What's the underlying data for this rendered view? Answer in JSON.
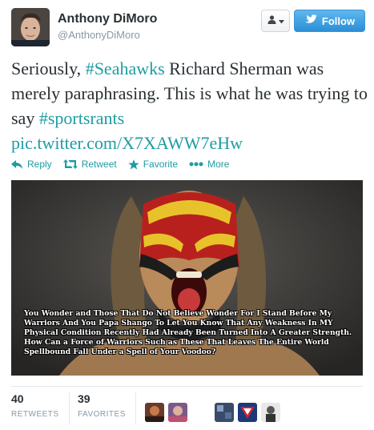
{
  "user": {
    "name": "Anthony DiMoro",
    "handle": "@AnthonyDiMoro"
  },
  "buttons": {
    "follow_label": "Follow"
  },
  "tweet": {
    "text_part1": "Seriously, ",
    "hashtag1": "#Seahawks",
    "text_part2": " Richard Sherman was merely paraphrasing. This is what he was trying to say ",
    "hashtag2": "#sportsrants",
    "link": "pic.twitter.com/X7XAWW7eHw"
  },
  "actions": {
    "reply": "Reply",
    "retweet": "Retweet",
    "favorite": "Favorite",
    "more": "More"
  },
  "photo": {
    "caption": "You Wonder and Those That Do Not Believe Wonder For I Stand Before My Warriors And You Papa Shango To Let You Know That Any Weakness In MY Physical Condition Recently Had Already Been Turned Into A Greater Strength. How Can a Force of Warriors Such as These That Leaves The Entire World Spellbound Fall Under a Spell of Your Voodoo?"
  },
  "stats": {
    "retweets_count": "40",
    "retweets_label": "RETWEETS",
    "favorites_count": "39",
    "favorites_label": "FAVORITES"
  },
  "colors": {
    "link": "#1e9ca3",
    "follow_bg": "#2b8fd6",
    "text": "#292f33",
    "muted": "#8899a6"
  }
}
